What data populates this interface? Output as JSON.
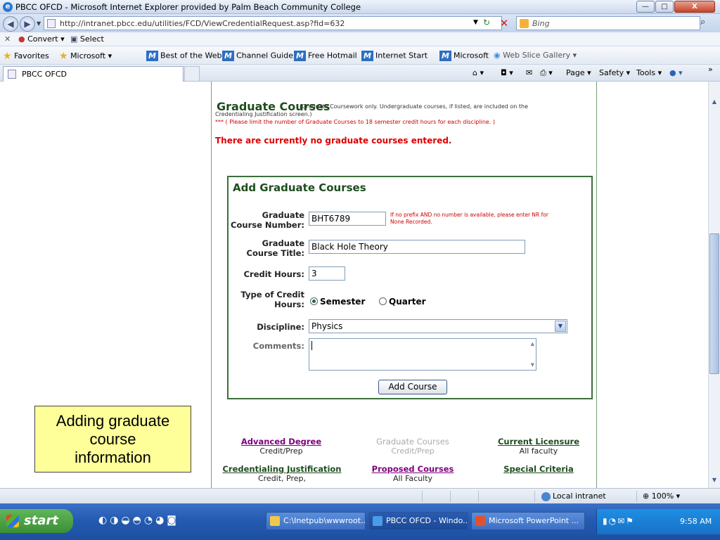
{
  "window": {
    "title": "PBCC OFCD - Microsoft Internet Explorer provided by Palm Beach Community College",
    "min_glyph": "—",
    "max_glyph": "□",
    "close_glyph": "X"
  },
  "address": {
    "url": "http://intranet.pbcc.edu/utilities/FCD/ViewCredentialRequest.asp?fid=632",
    "search_placeholder": "Bing"
  },
  "convert_bar": {
    "convert_label": "Convert",
    "select_label": "Select"
  },
  "favorites_bar": {
    "favorites_label": "Favorites",
    "items": [
      "Microsoft",
      "Best of the Web",
      "Channel Guide",
      "Free Hotmail",
      "Internet Start",
      "Microsoft",
      "Web Slice Gallery"
    ]
  },
  "tabs": {
    "active_tab": "PBCC OFCD",
    "commands": {
      "page": "Page",
      "safety": "Safety",
      "tools": "Tools"
    }
  },
  "page": {
    "section_title": "Graduate Courses",
    "section_note": "(Graduate Coursework only. Undergraduate courses, if listed, are included on the",
    "section_note2": "Credentialing Justification screen.)",
    "limit_note": "*** ( Please limit the number of Graduate Courses to 18 semester credit hours for each discipline. )",
    "no_courses": "There are currently no graduate courses entered.",
    "add_box": {
      "title": "Add Graduate Courses",
      "course_number_label_1": "Graduate",
      "course_number_label_2": "Course Number:",
      "course_number_value": "BHT6789",
      "hint_1": "If no prefix AND no number is available, please enter NR for",
      "hint_2": "None Recorded.",
      "course_title_label_1": "Graduate",
      "course_title_label_2": "Course Title:",
      "course_title_value": "Black Hole Theory",
      "credit_hours_label": "Credit Hours:",
      "credit_hours_value": "3",
      "credit_type_label_1": "Type of Credit",
      "credit_type_label_2": "Hours:",
      "option_semester": "Semester",
      "option_quarter": "Quarter",
      "selected_option": "Semester",
      "discipline_label": "Discipline:",
      "discipline_value": "Physics",
      "comments_label": "Comments:",
      "comments_value": "",
      "add_button": "Add Course"
    },
    "nav_links": [
      {
        "main": "Advanced Degree",
        "sub": "Credit/Prep"
      },
      {
        "main": "Graduate Courses",
        "sub": "Credit/Prep"
      },
      {
        "main": "Current Licensure",
        "sub": "All faculty"
      },
      {
        "main": "Credentialing Justification",
        "sub": "Credit, Prep,"
      },
      {
        "main": "Proposed Courses",
        "sub": "All Faculty"
      },
      {
        "main": "Special Criteria",
        "sub": ""
      }
    ],
    "callout_line1": "Adding graduate",
    "callout_line2": "course",
    "callout_line3": "information"
  },
  "status_bar": {
    "zone": "Local intranet",
    "zoom": "100%"
  },
  "taskbar": {
    "start": "start",
    "items": [
      {
        "label": "C:\\Inetpub\\wwwroot...",
        "icon_color": "#f2c94c"
      },
      {
        "label": "PBCC OFCD - Windo...",
        "icon_color": "#4a9be8"
      },
      {
        "label": "Microsoft PowerPoint ...",
        "icon_color": "#e0522d"
      }
    ],
    "clock": "9:58 AM"
  },
  "colors": {
    "section_green": "#1e4d1e",
    "alert_red": "#d00000",
    "link_purple": "#800080",
    "link_green": "#1e4d1e",
    "callout_yellow": "#ffff99"
  }
}
